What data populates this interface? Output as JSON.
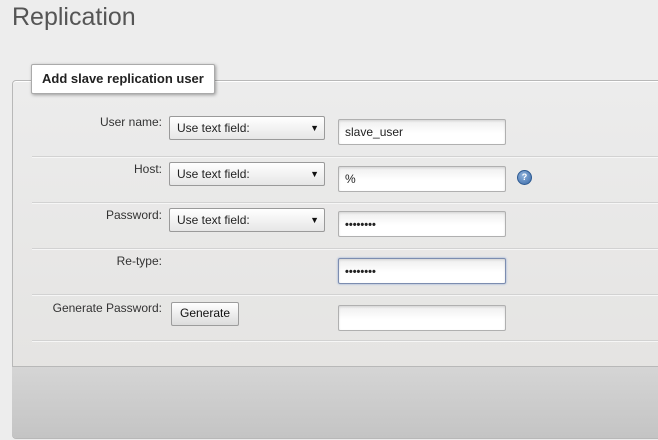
{
  "page": {
    "title": "Replication"
  },
  "form": {
    "legend": "Add slave replication user",
    "rows": [
      {
        "label": "User name:",
        "select": "Use text field:",
        "value": "slave_user"
      },
      {
        "label": "Host:",
        "select": "Use text field:",
        "value": "%"
      },
      {
        "label": "Password:",
        "select": "Use text field:",
        "value": "••••••••"
      },
      {
        "label": "Re-type:",
        "value": "••••••••"
      },
      {
        "label": "Generate Password:",
        "button": "Generate",
        "value": ""
      }
    ],
    "help_icon": "?"
  },
  "icons": {
    "dropdown": "chevron-down-icon",
    "help": "help-icon"
  }
}
